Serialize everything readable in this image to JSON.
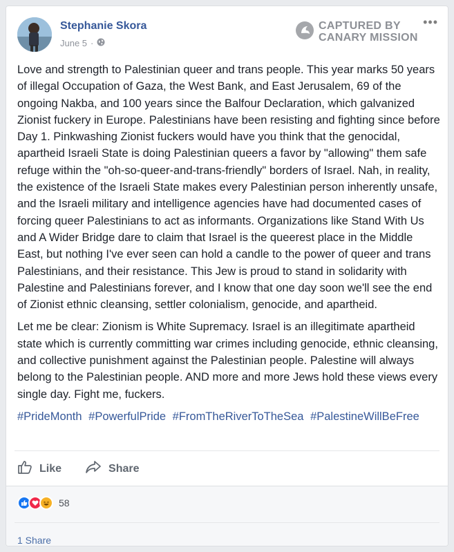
{
  "post": {
    "author": "Stephanie Skora",
    "date": "June 5",
    "separator": "·",
    "watermark_line1": "CAPTURED BY",
    "watermark_line2": "CANARY MISSION",
    "paragraphs": [
      "Love and strength to Palestinian queer and trans people. This year marks 50 years of illegal Occupation of Gaza, the West Bank, and East Jerusalem, 69 of the ongoing Nakba, and 100 years since the Balfour Declaration, which galvanized Zionist fuckery in Europe. Palestinians have been resisting and fighting since before Day 1. Pinkwashing Zionist fuckers would have you think that the genocidal, apartheid Israeli State is doing Palestinian queers a favor by \"allowing\" them safe refuge within the \"oh-so-queer-and-trans-friendly\" borders of Israel. Nah, in reality, the existence of the Israeli State makes every Palestinian person inherently unsafe, and the Israeli military and intelligence agencies have had documented cases of forcing queer Palestinians to act as informants. Organizations like Stand With Us and A Wider Bridge dare to claim that Israel is the queerest place in the Middle East, but nothing I've ever seen can hold a candle to the power of queer and trans Palestinians, and their resistance. This Jew is proud to stand in solidarity with Palestine and Palestinians forever, and I know that one day soon we'll see the end of Zionist ethnic cleansing, settler colonialism, genocide, and apartheid.",
      "Let me be clear: Zionism is White Supremacy. Israel is an illegitimate apartheid state which is currently committing war crimes including genocide, ethnic cleansing, and collective punishment against the Palestinian people. Palestine will always belong to the Palestinian people. AND more and more Jews hold these views every single day. Fight me, fuckers."
    ],
    "hashtags": [
      "#PrideMonth",
      "#PowerfulPride",
      "#FromTheRiverToTheSea",
      "#PalestineWillBeFree"
    ],
    "actions": {
      "like": "Like",
      "share": "Share"
    },
    "reactions": {
      "types": [
        "like-icon",
        "love-icon",
        "haha-icon"
      ],
      "count": "58"
    },
    "share_count": "1 Share"
  },
  "colors": {
    "link": "#365899",
    "like_blue": "#1877f2",
    "love_red": "#f0284a",
    "haha_yellow": "#f7b125"
  }
}
